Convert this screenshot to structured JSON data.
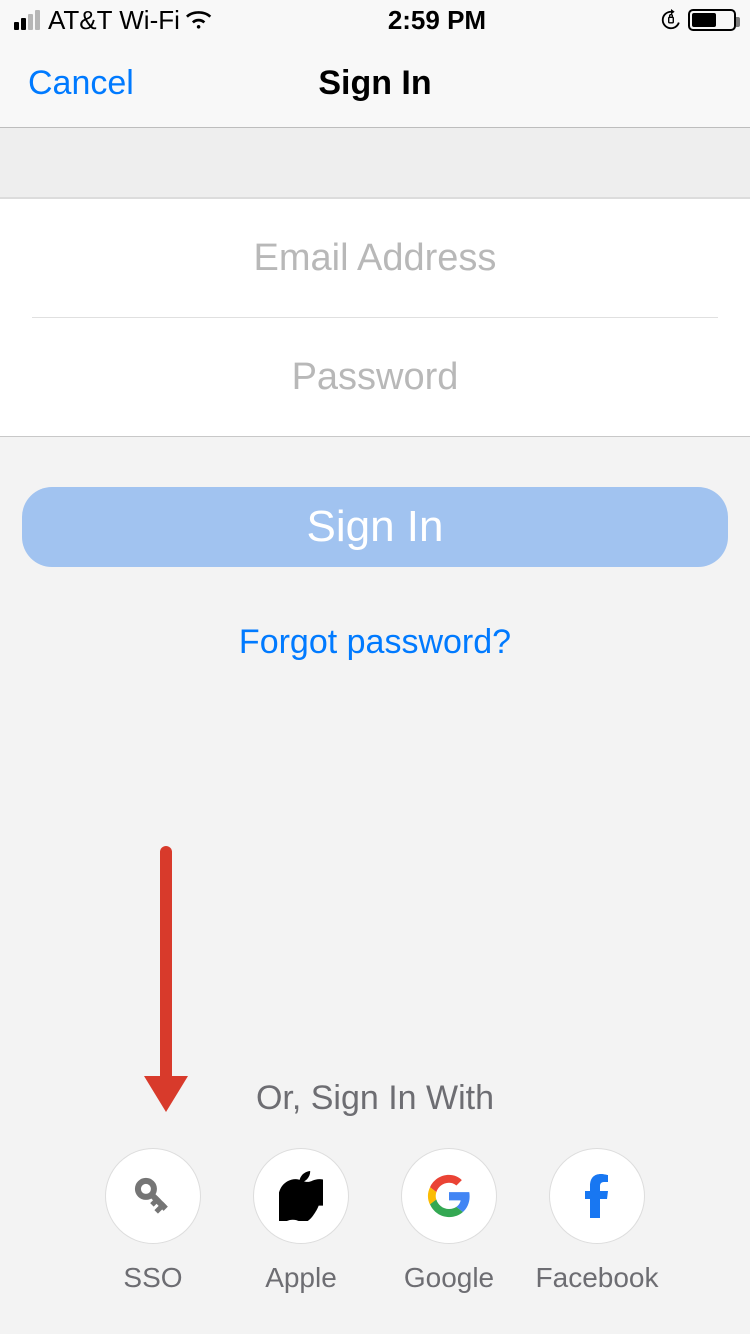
{
  "statusbar": {
    "carrier": "AT&T Wi-Fi",
    "time": "2:59 PM"
  },
  "nav": {
    "cancel": "Cancel",
    "title": "Sign In"
  },
  "form": {
    "email_placeholder": "Email Address",
    "password_placeholder": "Password"
  },
  "actions": {
    "signin": "Sign In",
    "forgot": "Forgot password?"
  },
  "alt": {
    "title": "Or, Sign In With",
    "providers": {
      "sso": "SSO",
      "apple": "Apple",
      "google": "Google",
      "facebook": "Facebook"
    }
  }
}
